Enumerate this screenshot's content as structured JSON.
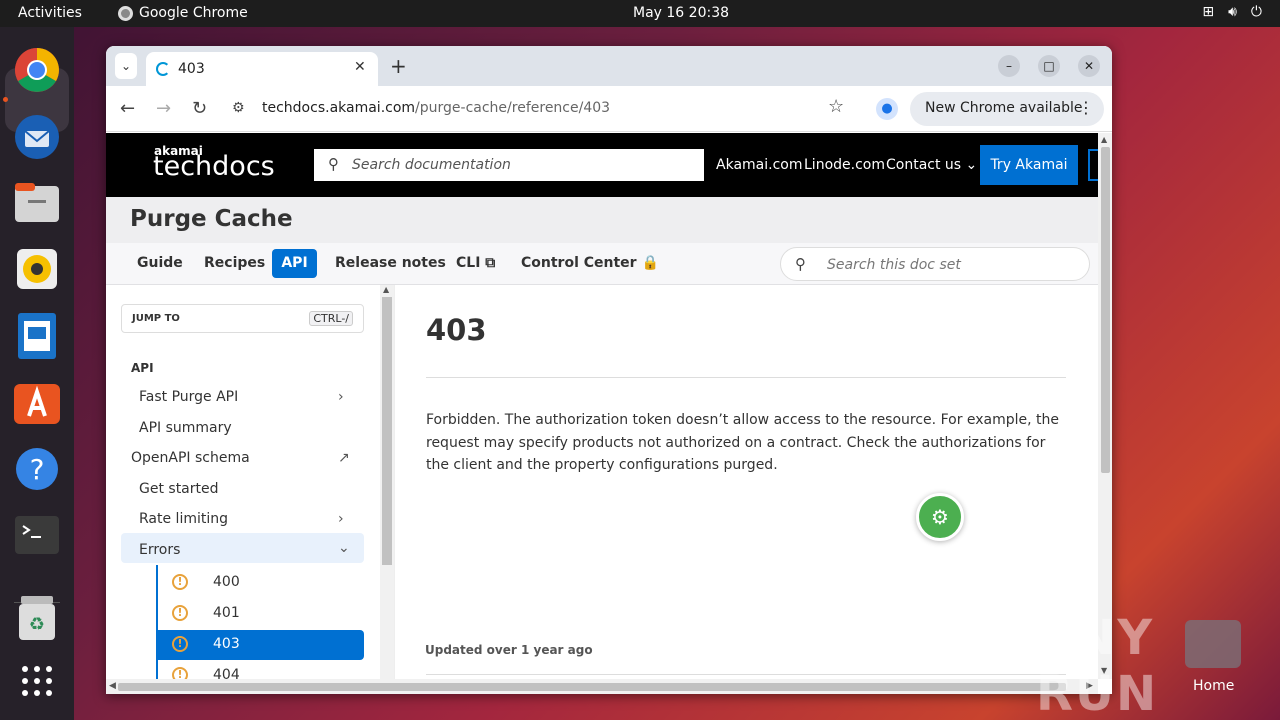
{
  "system": {
    "activities": "Activities",
    "app_name": "Google Chrome",
    "clock": "May 16  20:38",
    "tray_icons": [
      "network-icon",
      "volume-icon",
      "power-icon"
    ]
  },
  "dock": {
    "items": [
      "chrome-icon",
      "thunderbird-icon",
      "files-icon",
      "rhythmbox-icon",
      "writer-icon",
      "app-center-icon",
      "help-icon",
      "terminal-icon",
      "trash-icon",
      "app-grid-icon"
    ]
  },
  "desktop": {
    "home_label": "Home",
    "watermark": "ANY RUN"
  },
  "browser": {
    "tab_title": "403",
    "tab_close": "✕",
    "new_tab": "+",
    "url_host": "techdocs.akamai.com",
    "url_path": "/purge-cache/reference/403",
    "update_label": "New Chrome available",
    "min": "–",
    "max": "□",
    "close": "✕"
  },
  "header": {
    "logo_small": "akamai",
    "logo_big": "techdocs",
    "search_placeholder": "Search documentation",
    "links": [
      "Akamai.com",
      "Linode.com",
      "Contact us ⌄"
    ],
    "try_button": "Try Akamai"
  },
  "product": {
    "title": "Purge Cache"
  },
  "subnav": {
    "items": [
      "Guide",
      "Recipes",
      "API",
      "Release notes",
      "CLI ⧉",
      "Control Center 🔒"
    ],
    "active": "API",
    "search_placeholder": "Search this doc set"
  },
  "sidebar": {
    "jump_label": "JUMP TO",
    "jump_shortcut": "CTRL-/",
    "heading": "API",
    "items": [
      "Fast Purge API",
      "API summary",
      "OpenAPI schema",
      "Get started",
      "Rate limiting",
      "Errors"
    ],
    "errors": [
      "400",
      "401",
      "403",
      "404"
    ],
    "active_error": "403"
  },
  "content": {
    "title": "403",
    "description": "Forbidden. The authorization token doesn’t allow access to the resource. For example, the request may specify products not authorized on a contract. Check the authorizations for the client and the property configurations purged.",
    "updated": "Updated over 1 year ago"
  }
}
